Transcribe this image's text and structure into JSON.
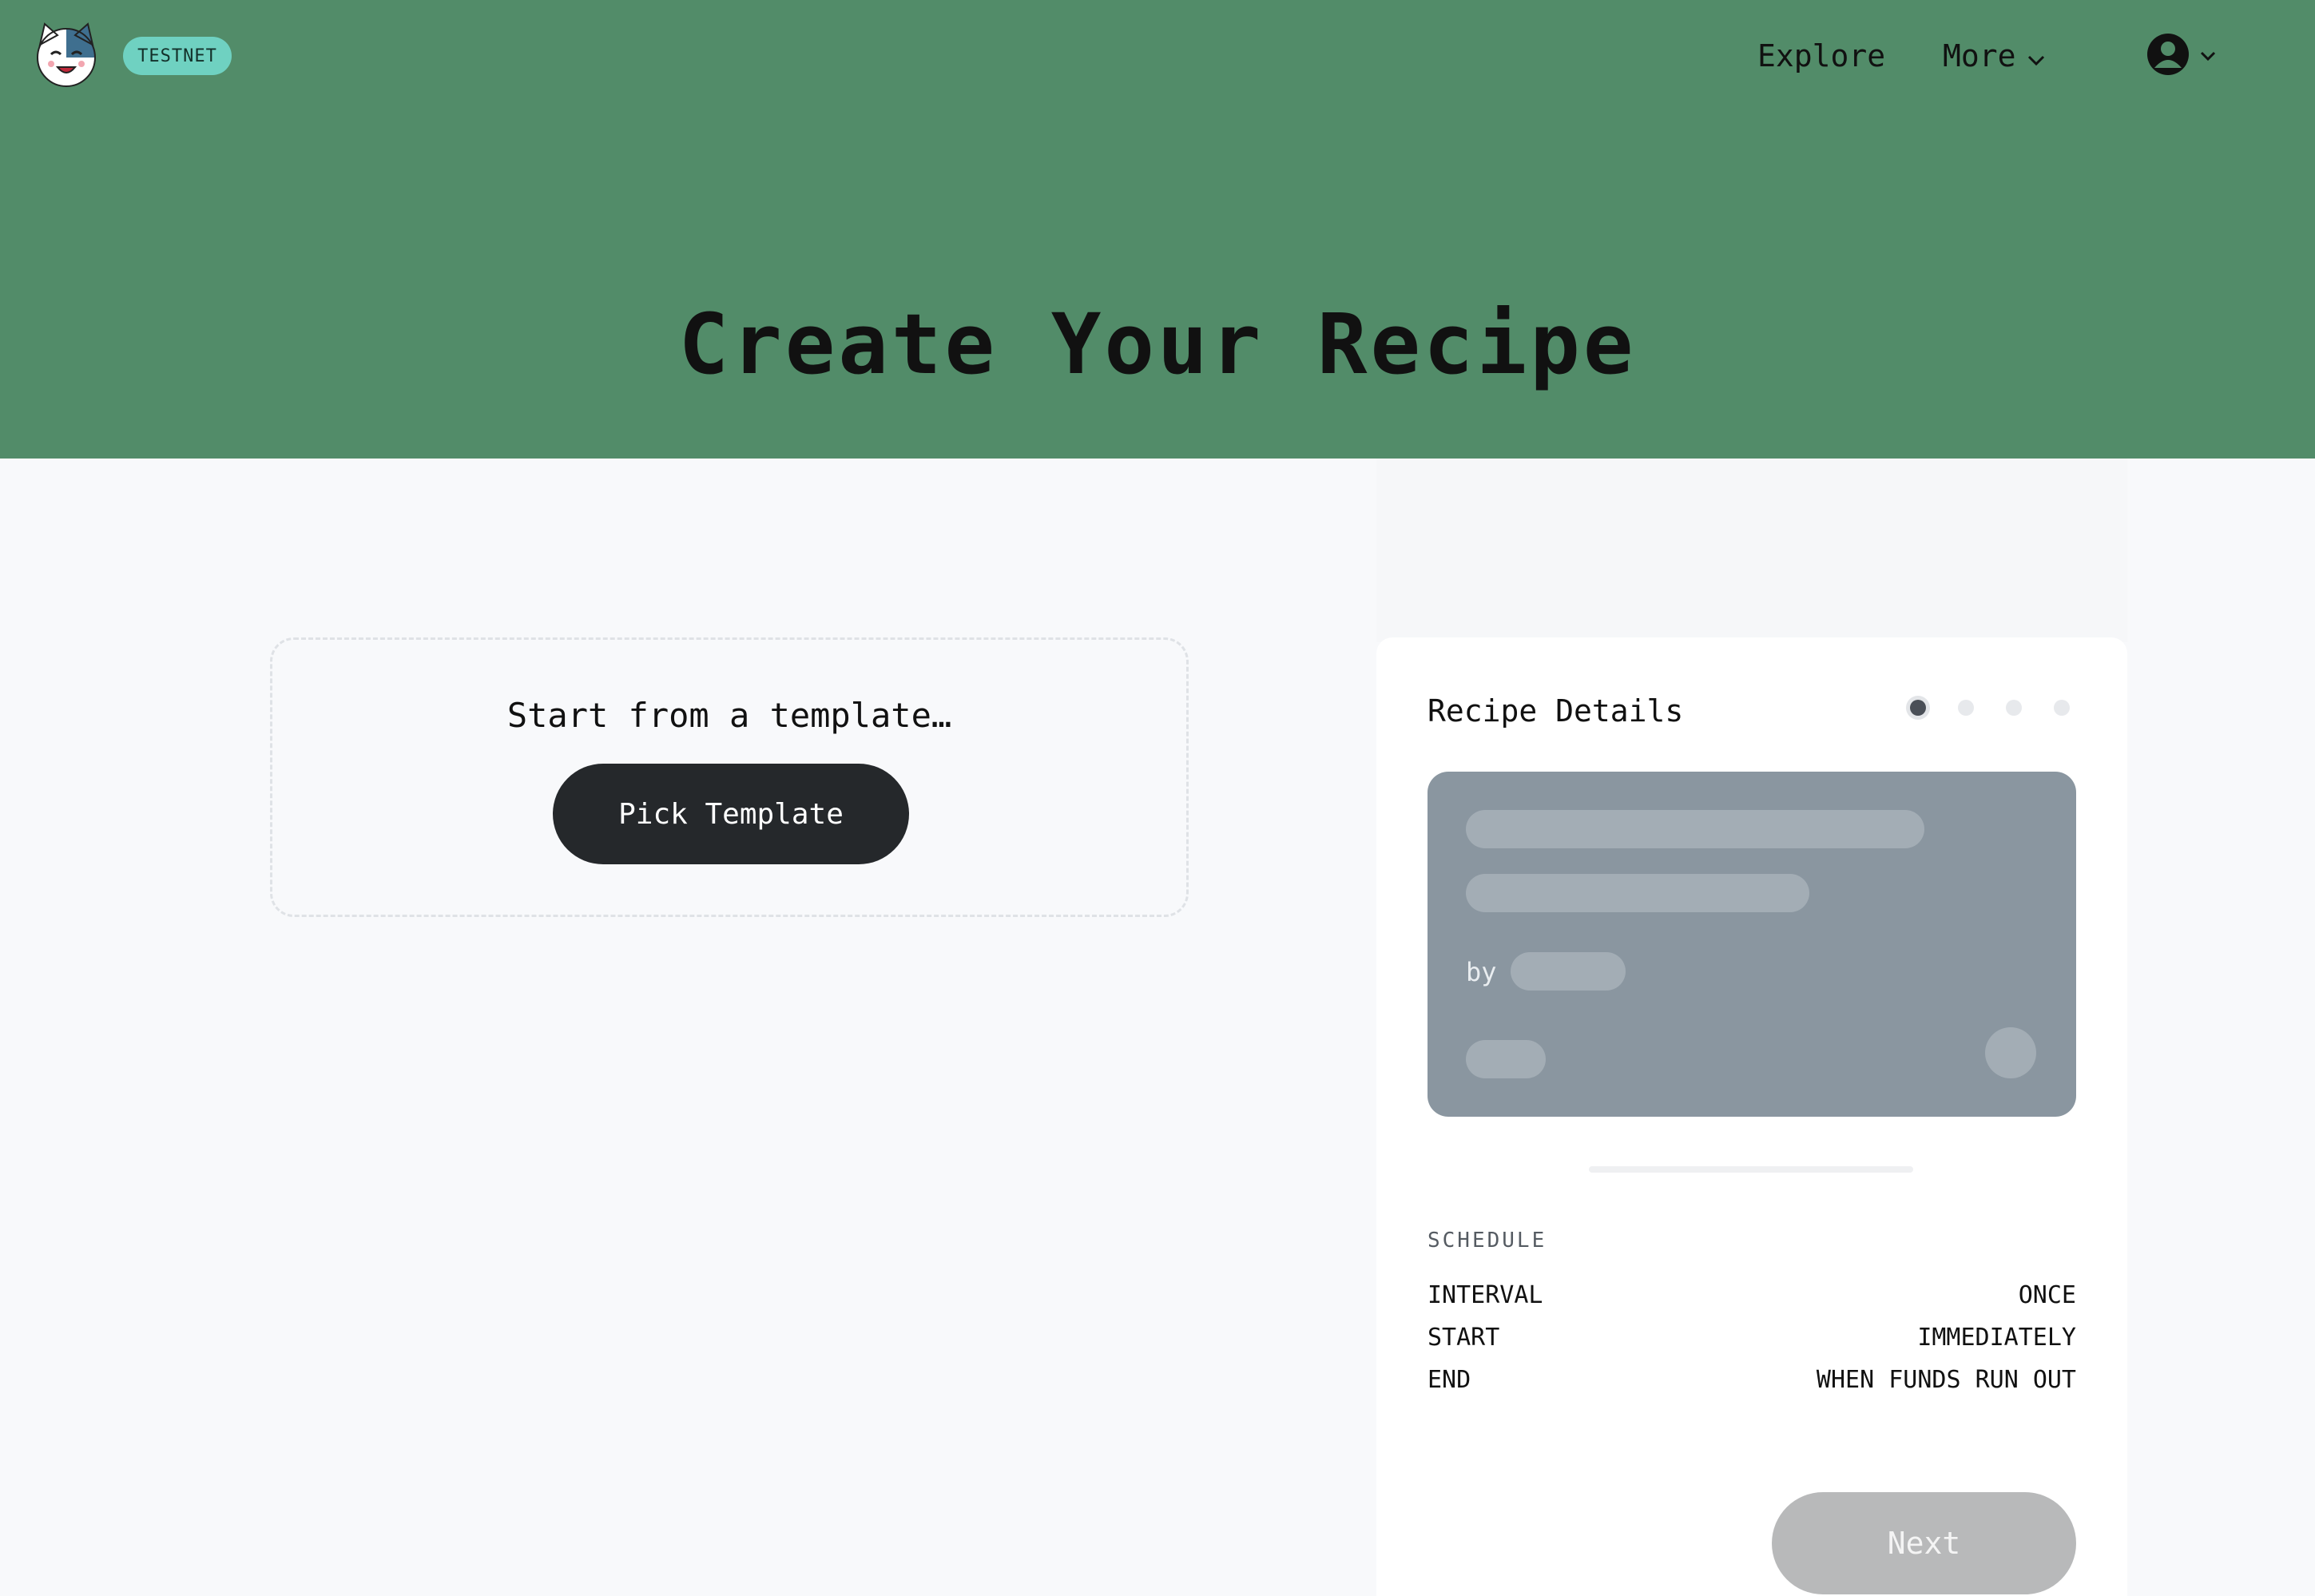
{
  "header": {
    "badge": "TESTNET",
    "nav": {
      "explore": "Explore",
      "more": "More"
    },
    "logo_icon": "cat-logo-icon",
    "user_icon": "user-circle-icon"
  },
  "hero": {
    "title": "Create Your Recipe",
    "background_color": "#528c69"
  },
  "template": {
    "prompt": "Start from a template…",
    "button": "Pick Template"
  },
  "panel": {
    "title": "Recipe Details",
    "steps_total": 4,
    "current_step": 1,
    "preview": {
      "by_label": "by"
    },
    "schedule": {
      "heading": "SCHEDULE",
      "rows": [
        {
          "label": "INTERVAL",
          "value": "ONCE"
        },
        {
          "label": "START",
          "value": "IMMEDIATELY"
        },
        {
          "label": "END",
          "value": "WHEN FUNDS RUN OUT"
        }
      ]
    },
    "next_button": "Next"
  }
}
